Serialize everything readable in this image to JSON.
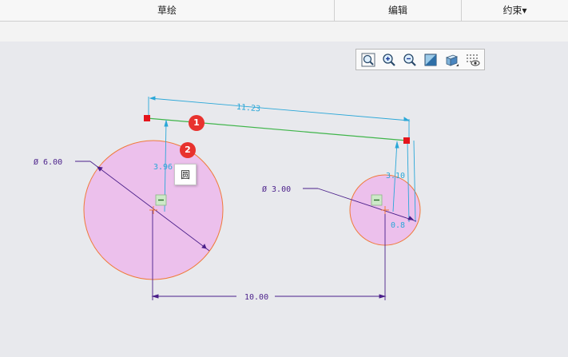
{
  "menubar": {
    "items": [
      {
        "label": "草绘"
      },
      {
        "label": "编辑"
      },
      {
        "label": "约束▾"
      }
    ]
  },
  "toolbar": {
    "buttons": [
      {
        "icon": "refit-zoom-icon"
      },
      {
        "icon": "zoom-in-icon"
      },
      {
        "icon": "zoom-out-icon"
      },
      {
        "icon": "sketch-orient-icon"
      },
      {
        "icon": "display-style-icon"
      },
      {
        "icon": "sketcher-display-filter-icon"
      }
    ]
  },
  "sketch": {
    "dimensions": {
      "top_length": "11.23",
      "left_vertical": "3.96",
      "right_vertical": "3.10",
      "right_small": "0.8",
      "center_distance": "10.00",
      "left_diameter": "Ø 6.00",
      "right_diameter": "Ø 3.00"
    },
    "badges": [
      "1",
      "2"
    ],
    "tooltip": "圆",
    "colors": {
      "circle_fill": "#ecc0ec",
      "circle_stroke": "#f07a3a",
      "tangent_line": "#3fb54a",
      "dimension": "#2aa7d8",
      "dimension_dark": "#4a1f8a",
      "endpoint": "#e4141b",
      "badge": "#e8322e"
    }
  }
}
